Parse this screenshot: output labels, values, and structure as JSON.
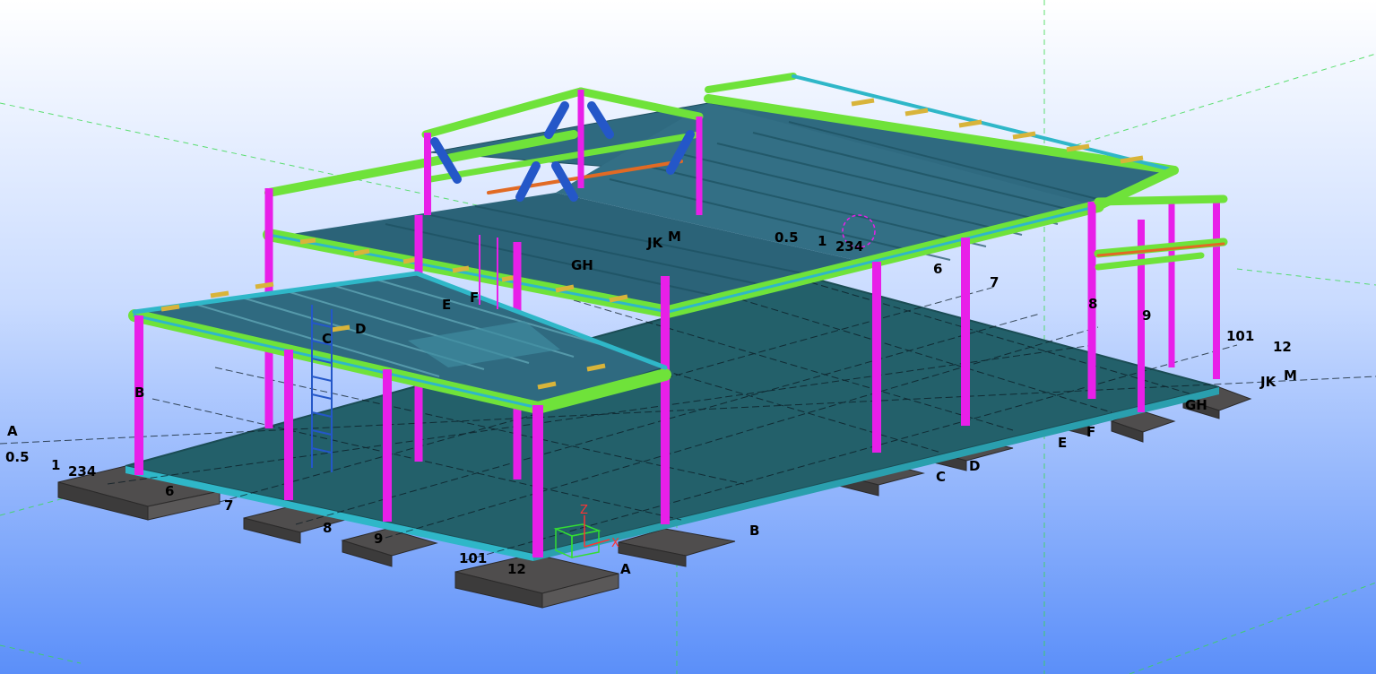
{
  "view": {
    "background_top": "#ffffff",
    "background_bottom": "#5b8ff9",
    "colors": {
      "column": "#e81fe8",
      "beam": "#6fe23a",
      "member": "#2fb7c8",
      "deck": "#2f6a80",
      "slab": "#23606a",
      "footing": "#4f4d4d",
      "bracing": "#2457c8",
      "purlin": "#d8b43a"
    }
  },
  "grid_labels_front": {
    "a": "A",
    "half": "0.5",
    "one": "1",
    "twothreefour": "234",
    "six": "6",
    "seven": "7",
    "eight": "8",
    "nine": "9",
    "tenone": "101",
    "twelve": "12",
    "gh": "GH"
  },
  "grid_labels_right": {
    "a": "A",
    "b": "B",
    "c": "C",
    "d": "D",
    "e": "E",
    "f": "F",
    "gh": "GH",
    "jk": "JK",
    "m": "M",
    "tenone": "101",
    "twelve": "12"
  },
  "grid_labels_upper": {
    "half": "0.5",
    "one": "1",
    "twothreefour": "234",
    "six": "6",
    "seven": "7",
    "eight": "8",
    "nine": "9",
    "jk": "JK",
    "m": "M",
    "gh": "GH"
  },
  "grid_labels_mezzanine": {
    "b": "B",
    "c": "C",
    "d": "D",
    "e": "E",
    "f": "F"
  },
  "axis": {
    "z": "Z",
    "x": "X"
  }
}
